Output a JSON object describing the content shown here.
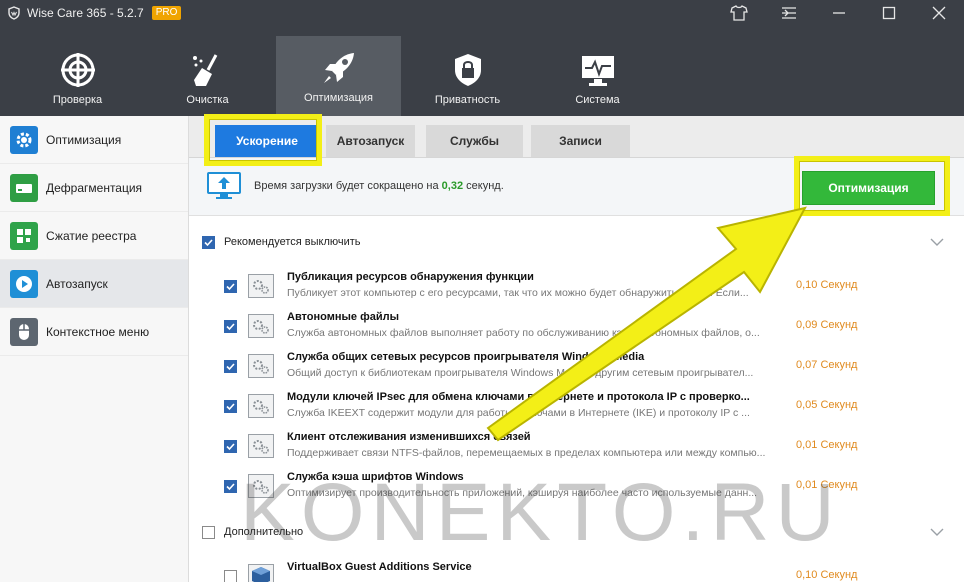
{
  "window": {
    "title": "Wise Care 365 - 5.2.7",
    "badge": "PRO",
    "controls": [
      "tshirt-icon",
      "menu-icon",
      "minimize-icon",
      "maximize-icon",
      "close-icon"
    ]
  },
  "topnav": {
    "items": [
      {
        "label": "Проверка",
        "icon": "radar-icon"
      },
      {
        "label": "Очистка",
        "icon": "broom-icon"
      },
      {
        "label": "Оптимизация",
        "icon": "rocket-icon",
        "active": true
      },
      {
        "label": "Приватность",
        "icon": "lock-icon"
      },
      {
        "label": "Система",
        "icon": "monitor-icon"
      }
    ]
  },
  "sidebar": {
    "items": [
      {
        "label": "Оптимизация",
        "icon": "gear-icon",
        "color": "#1f7fd3"
      },
      {
        "label": "Дефрагментация",
        "icon": "disk-icon",
        "color": "#2f9e44"
      },
      {
        "label": "Сжатие реестра",
        "icon": "blocks-icon",
        "color": "#2fa34a"
      },
      {
        "label": "Автозапуск",
        "icon": "play-icon",
        "color": "#1f8fd6",
        "active": true
      },
      {
        "label": "Контекстное меню",
        "icon": "mouse-icon",
        "color": "#5d6670"
      }
    ]
  },
  "subtabs": [
    {
      "label": "Ускорение",
      "active": true
    },
    {
      "label": "Автозапуск"
    },
    {
      "label": "Службы"
    },
    {
      "label": "Записи"
    }
  ],
  "infobar": {
    "text_before": "Время загрузки будет сокращено на ",
    "value": "0,32",
    "text_after": " секунд.",
    "button": "Оптимизация"
  },
  "sections": {
    "recommended": {
      "label": "Рекомендуется выключить",
      "checked": true,
      "items": [
        {
          "name": "Публикация ресурсов обнаружения функции",
          "desc": "Публикует этот компьютер с его ресурсами, так что их можно будет обнаружить в сети.  Если...",
          "time": "0,10 Секунд",
          "checked": true
        },
        {
          "name": "Автономные файлы",
          "desc": "Служба автономных файлов выполняет работу по обслуживанию кэша автономных файлов, о...",
          "time": "0,09 Секунд",
          "checked": true
        },
        {
          "name": "Служба общих сетевых ресурсов проигрывателя Windows Media",
          "desc": "Общий доступ к библиотекам проигрывателя Windows Media к другим сетевым проигрывател...",
          "time": "0,07 Секунд",
          "checked": true
        },
        {
          "name": "Модули ключей IPsec для обмена ключами в Интернете и протокола IP с проверко...",
          "desc": "Служба IKEEXT содержит модули для работы с ключами в Интернете (IKE) и протоколу IP с ...",
          "time": "0,05 Секунд",
          "checked": true
        },
        {
          "name": "Клиент отслеживания изменившихся связей",
          "desc": "Поддерживает связи NTFS-файлов, перемещаемых в пределах компьютера или между компью...",
          "time": "0,01 Секунд",
          "checked": true
        },
        {
          "name": "Служба кэша шрифтов Windows",
          "desc": "Оптимизирует производительность приложений, кэшируя наиболее часто используемые данн...",
          "time": "0,01 Секунд",
          "checked": true
        }
      ]
    },
    "additional": {
      "label": "Дополнительно",
      "checked": false,
      "items": [
        {
          "name": "VirtualBox Guest Additions Service",
          "desc": "",
          "time": "0,10 Секунд",
          "checked": false
        }
      ]
    }
  },
  "annotations": {
    "highlight_color": "#f3ef17",
    "watermark": "KONEKTO.RU"
  }
}
